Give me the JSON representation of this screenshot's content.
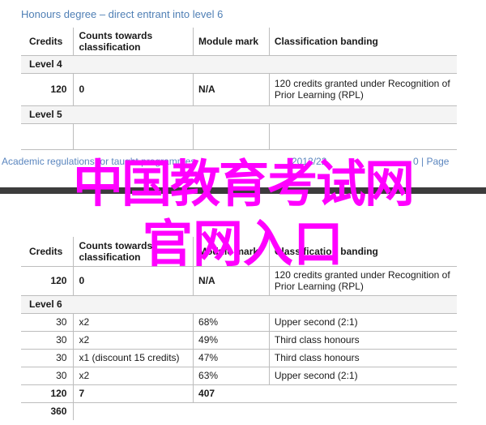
{
  "page1": {
    "heading": "Honours degree – direct entrant into level 6",
    "headers": [
      "Credits",
      "Counts towards classification",
      "Module mark",
      "Classification banding"
    ],
    "level4": "Level 4",
    "row1": {
      "credits": "120",
      "counts": "0",
      "mark": "N/A",
      "banding": "120 credits granted under Recognition of Prior Learning (RPL)"
    },
    "level5": "Level 5"
  },
  "footer": {
    "left": "Academic regulations for taught programmes",
    "year": "2012/22",
    "page": "0 | Page"
  },
  "overlay": {
    "line1": "中国教育考试网",
    "line2": "官网入口"
  },
  "page2": {
    "headers": [
      "Credits",
      "Counts towards classification",
      "Module mark",
      "Classification banding"
    ],
    "row_rpl": {
      "credits": "120",
      "counts": "0",
      "mark": "N/A",
      "banding": "120 credits granted under Recognition of Prior Learning (RPL)"
    },
    "level6": "Level 6",
    "rows": [
      {
        "credits": "30",
        "counts": "x2",
        "mark": "68%",
        "banding": "Upper second (2:1)"
      },
      {
        "credits": "30",
        "counts": "x2",
        "mark": "49%",
        "banding": "Third class honours"
      },
      {
        "credits": "30",
        "counts": "x1 (discount 15 credits)",
        "mark": "47%",
        "banding": "Third class honours"
      },
      {
        "credits": "30",
        "counts": "x2",
        "mark": "63%",
        "banding": "Upper second (2:1)"
      }
    ],
    "total": {
      "credits": "120",
      "counts": "7",
      "mark": "407"
    },
    "grand_total": "360"
  }
}
